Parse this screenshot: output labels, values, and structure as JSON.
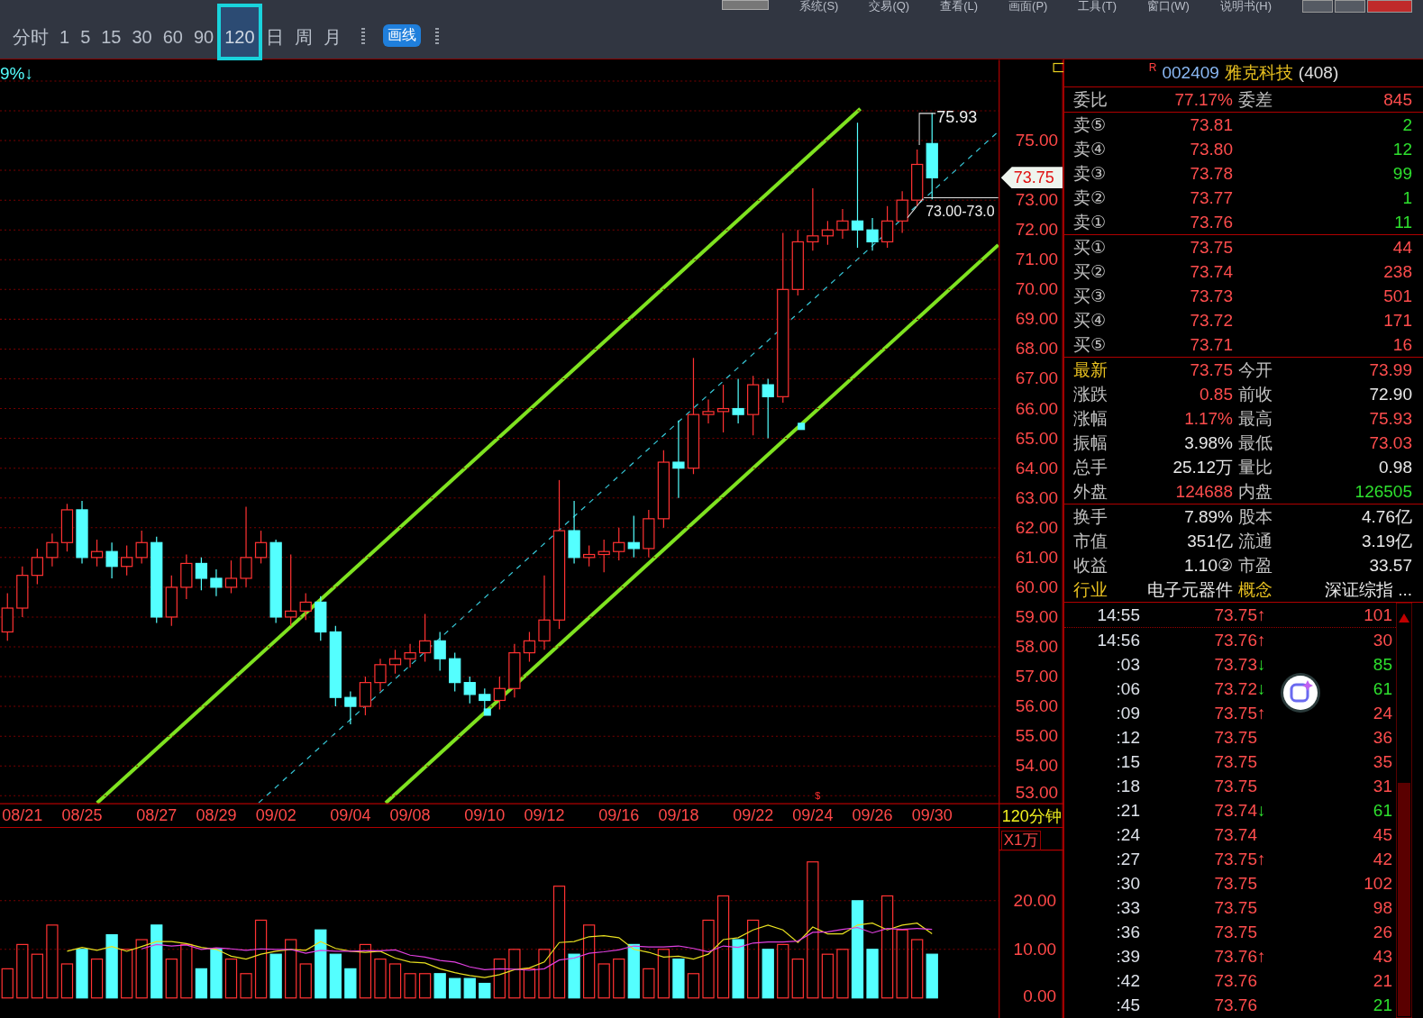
{
  "menu": [
    "系统(S)",
    "交易(Q)",
    "查看(L)",
    "画面(P)",
    "工具(T)",
    "窗口(W)",
    "说明书(H)"
  ],
  "toolbar": {
    "periods": [
      {
        "label": "分时",
        "selected": false
      },
      {
        "label": "1",
        "selected": false
      },
      {
        "label": "5",
        "selected": false
      },
      {
        "label": "15",
        "selected": false
      },
      {
        "label": "30",
        "selected": false
      },
      {
        "label": "60",
        "selected": false
      },
      {
        "label": "90",
        "selected": false
      },
      {
        "label": "120",
        "selected": true
      },
      {
        "label": "日",
        "selected": false
      },
      {
        "label": "周",
        "selected": false
      },
      {
        "label": "月",
        "selected": false
      }
    ],
    "draw_button": "画线"
  },
  "chart": {
    "change_label": "9%↓",
    "current_price": "73.75",
    "high_label": "75.93",
    "range_label": "73.00-73.0",
    "event_mark": "$",
    "period_label": "120分钟",
    "chart_data": {
      "type": "candlestick",
      "grid": true,
      "categories": [
        null,
        "08/21",
        null,
        null,
        null,
        "08/25",
        null,
        null,
        null,
        null,
        "08/27",
        null,
        null,
        null,
        "08/29",
        null,
        null,
        null,
        "09/02",
        null,
        null,
        null,
        null,
        "09/04",
        null,
        null,
        null,
        "09/08",
        null,
        null,
        null,
        null,
        "09/10",
        null,
        null,
        null,
        "09/12",
        null,
        null,
        null,
        null,
        "09/16",
        null,
        null,
        null,
        "09/18",
        null,
        null,
        null,
        null,
        "09/22",
        null,
        null,
        null,
        "09/24",
        null,
        null,
        null,
        "09/26",
        null,
        null,
        null,
        "09/30",
        null,
        null,
        null,
        null
      ],
      "ohlc": [
        [
          58.5,
          59.8,
          58.2,
          59.3
        ],
        [
          59.3,
          60.7,
          59.0,
          60.4
        ],
        [
          60.4,
          61.3,
          60.1,
          61.0
        ],
        [
          61.0,
          61.8,
          60.7,
          61.5
        ],
        [
          61.5,
          62.8,
          61.2,
          62.6
        ],
        [
          62.6,
          62.9,
          60.8,
          61.0
        ],
        [
          61.0,
          61.6,
          60.7,
          61.2
        ],
        [
          61.2,
          61.5,
          60.3,
          60.7
        ],
        [
          60.7,
          61.4,
          60.4,
          61.0
        ],
        [
          61.0,
          61.9,
          60.8,
          61.5
        ],
        [
          61.5,
          61.7,
          58.8,
          59.0
        ],
        [
          59.0,
          60.4,
          58.7,
          60.0
        ],
        [
          60.0,
          61.1,
          59.6,
          60.8
        ],
        [
          60.8,
          61.0,
          59.9,
          60.3
        ],
        [
          60.3,
          60.6,
          59.7,
          60.0
        ],
        [
          60.0,
          60.9,
          59.8,
          60.3
        ],
        [
          60.3,
          62.7,
          60.0,
          61.0
        ],
        [
          61.0,
          61.9,
          60.8,
          61.5
        ],
        [
          61.5,
          61.6,
          58.8,
          59.0
        ],
        [
          59.0,
          61.1,
          58.7,
          59.2
        ],
        [
          59.2,
          59.8,
          58.9,
          59.5
        ],
        [
          59.5,
          59.7,
          58.2,
          58.5
        ],
        [
          58.5,
          58.7,
          56.0,
          56.3
        ],
        [
          56.3,
          56.5,
          55.4,
          56.0
        ],
        [
          56.0,
          57.0,
          55.7,
          56.8
        ],
        [
          56.8,
          57.6,
          56.5,
          57.4
        ],
        [
          57.4,
          57.9,
          57.1,
          57.6
        ],
        [
          57.6,
          58.1,
          57.3,
          57.8
        ],
        [
          57.8,
          59.1,
          57.5,
          58.2
        ],
        [
          58.2,
          58.5,
          57.2,
          57.6
        ],
        [
          57.6,
          57.8,
          56.5,
          56.8
        ],
        [
          56.8,
          57.0,
          56.1,
          56.4
        ],
        [
          56.4,
          56.6,
          55.9,
          56.2
        ],
        [
          56.2,
          57.0,
          55.9,
          56.6
        ],
        [
          56.6,
          58.1,
          56.3,
          57.8
        ],
        [
          57.8,
          58.5,
          57.5,
          58.2
        ],
        [
          58.2,
          60.4,
          57.9,
          58.9
        ],
        [
          58.9,
          63.6,
          58.6,
          61.9
        ],
        [
          61.9,
          62.9,
          60.8,
          61.0
        ],
        [
          61.0,
          61.4,
          60.7,
          61.1
        ],
        [
          61.1,
          61.6,
          60.5,
          61.2
        ],
        [
          61.2,
          62.0,
          60.9,
          61.5
        ],
        [
          61.5,
          62.4,
          61.0,
          61.3
        ],
        [
          61.3,
          62.6,
          61.0,
          62.3
        ],
        [
          62.3,
          64.6,
          62.0,
          64.2
        ],
        [
          64.2,
          65.6,
          63.0,
          64.0
        ],
        [
          64.0,
          67.7,
          63.8,
          65.8
        ],
        [
          65.8,
          66.3,
          65.5,
          65.9
        ],
        [
          65.9,
          66.8,
          65.2,
          66.0
        ],
        [
          66.0,
          67.0,
          65.5,
          65.8
        ],
        [
          65.8,
          67.1,
          65.1,
          66.8
        ],
        [
          66.8,
          67.0,
          65.0,
          66.4
        ],
        [
          66.4,
          71.9,
          66.2,
          70.0
        ],
        [
          70.0,
          72.0,
          69.8,
          71.6
        ],
        [
          71.6,
          73.4,
          71.3,
          71.8
        ],
        [
          71.8,
          72.3,
          71.5,
          72.0
        ],
        [
          72.0,
          72.7,
          71.7,
          72.3
        ],
        [
          72.3,
          75.6,
          71.4,
          72.0
        ],
        [
          72.0,
          72.4,
          71.3,
          71.6
        ],
        [
          71.6,
          72.8,
          71.4,
          72.3
        ],
        [
          72.3,
          73.3,
          71.9,
          73.0
        ],
        [
          73.0,
          74.7,
          72.8,
          74.2
        ],
        [
          74.9,
          75.93,
          73.03,
          73.75
        ],
        null,
        null,
        null,
        null
      ],
      "yticks": [
        {
          "value": 75,
          "label": "75.00"
        },
        {
          "value": 73,
          "label": "73.00"
        },
        {
          "value": 72,
          "label": "72.00"
        },
        {
          "value": 71,
          "label": "71.00"
        },
        {
          "value": 70,
          "label": "70.00"
        },
        {
          "value": 69,
          "label": "69.00"
        },
        {
          "value": 68,
          "label": "68.00"
        },
        {
          "value": 67,
          "label": "67.00"
        },
        {
          "value": 66,
          "label": "66.00"
        },
        {
          "value": 65,
          "label": "65.00"
        },
        {
          "value": 64,
          "label": "64.00"
        },
        {
          "value": 63,
          "label": "63.00"
        },
        {
          "value": 62,
          "label": "62.00"
        },
        {
          "value": 61,
          "label": "61.00"
        },
        {
          "value": 60,
          "label": "60.00"
        },
        {
          "value": 59,
          "label": "59.00"
        },
        {
          "value": 58,
          "label": "58.00"
        },
        {
          "value": 57,
          "label": "57.00"
        },
        {
          "value": 56,
          "label": "56.00"
        },
        {
          "value": 55,
          "label": "55.00"
        },
        {
          "value": 54,
          "label": "54.00"
        },
        {
          "value": 53,
          "label": "53.00"
        }
      ],
      "ylim": [
        52.73,
        77.71
      ]
    }
  },
  "volume": {
    "unit": "X1万",
    "chart_data": {
      "type": "bar",
      "grid": true,
      "series": [
        {
          "type": "bar",
          "color": "#ff3232",
          "values": [
            6,
            11,
            9,
            15,
            7,
            null,
            8,
            null,
            10,
            12,
            null,
            8,
            11,
            null,
            null,
            8,
            5,
            16,
            null,
            12,
            7,
            null,
            null,
            null,
            11,
            8,
            7,
            5,
            5,
            null,
            null,
            null,
            null,
            8,
            10,
            6,
            10,
            23,
            null,
            15,
            7,
            8,
            null,
            6,
            10,
            null,
            5,
            16,
            21,
            null,
            16,
            null,
            11,
            8,
            28,
            9,
            10,
            null,
            null,
            21,
            14,
            12,
            null,
            null,
            null,
            null,
            null
          ]
        },
        {
          "type": "bar",
          "color": "#54ffff",
          "values": [
            null,
            null,
            null,
            null,
            null,
            10,
            null,
            13,
            null,
            null,
            15,
            null,
            null,
            6,
            10,
            null,
            null,
            null,
            9,
            null,
            null,
            14,
            9,
            6,
            null,
            null,
            null,
            null,
            null,
            5,
            4,
            4,
            3,
            null,
            null,
            null,
            null,
            null,
            9,
            null,
            null,
            null,
            11,
            null,
            null,
            8,
            null,
            null,
            null,
            12,
            null,
            10,
            null,
            null,
            null,
            null,
            null,
            20,
            10,
            null,
            null,
            null,
            9,
            null,
            null,
            null,
            null
          ]
        },
        {
          "type": "line",
          "color": "#e8e020",
          "values": [
            null,
            null,
            null,
            null,
            9.6,
            10.4,
            9.8,
            10.6,
            9.6,
            10.6,
            11.6,
            11.6,
            11.2,
            10.4,
            10,
            8.6,
            8,
            9,
            9.6,
            10,
            9.8,
            11.6,
            10.2,
            9.6,
            9.4,
            9.6,
            8.2,
            7.4,
            7.2,
            6,
            5.2,
            4.6,
            4.2,
            4.8,
            5.8,
            6.2,
            7.4,
            11.4,
            11.6,
            12.6,
            12.8,
            12.4,
            10,
            9.4,
            8.4,
            8.6,
            8,
            9,
            12,
            12.4,
            14,
            15,
            14,
            11.4,
            14.6,
            13.2,
            13.2,
            15,
            15.4,
            14,
            15,
            15.4,
            13.2,
            null,
            null,
            null,
            null
          ]
        },
        {
          "type": "line",
          "color": "#e040e0",
          "values": [
            null,
            null,
            null,
            null,
            null,
            null,
            null,
            null,
            null,
            10.1,
            11,
            10.7,
            10.9,
            10,
            10.3,
            10.1,
            9.8,
            10.1,
            10,
            10,
            9.2,
            9.8,
            9.6,
            9.6,
            9.7,
            9.7,
            9.9,
            8.8,
            8.4,
            7.7,
            7.4,
            6.4,
            5.8,
            6,
            5.9,
            5.7,
            6,
            7.8,
            8.2,
            9.2,
            9.5,
            9.9,
            10.7,
            10.5,
            10.5,
            10.7,
            10.2,
            9.5,
            10.7,
            10.4,
            11.3,
            11.5,
            11.5,
            11.7,
            13.5,
            13.6,
            14.1,
            14.5,
            13.4,
            14.3,
            14.1,
            14.3,
            14.1,
            null,
            null,
            null,
            null
          ]
        }
      ],
      "yticks": [
        {
          "value": 20,
          "label": "20.00"
        },
        {
          "value": 10,
          "label": "10.00"
        },
        {
          "value": 0,
          "label": "0.00"
        }
      ],
      "ylim": [
        0,
        35.1
      ]
    }
  },
  "quote": {
    "marker": "R",
    "code": "002409",
    "name": "雅克科技",
    "count": "(408)",
    "ratio": {
      "label": "委比",
      "value": "77.17%",
      "label2": "委差",
      "value2": "845"
    },
    "asks": [
      {
        "label": "卖⑤",
        "price": "73.81",
        "volume": "2"
      },
      {
        "label": "卖④",
        "price": "73.80",
        "volume": "12"
      },
      {
        "label": "卖③",
        "price": "73.78",
        "volume": "99"
      },
      {
        "label": "卖②",
        "price": "73.77",
        "volume": "1"
      },
      {
        "label": "卖①",
        "price": "73.76",
        "volume": "11"
      }
    ],
    "bids": [
      {
        "label": "买①",
        "price": "73.75",
        "volume": "44"
      },
      {
        "label": "买②",
        "price": "73.74",
        "volume": "238"
      },
      {
        "label": "买③",
        "price": "73.73",
        "volume": "501"
      },
      {
        "label": "买④",
        "price": "73.72",
        "volume": "171"
      },
      {
        "label": "买⑤",
        "price": "73.71",
        "volume": "16"
      }
    ],
    "stats": [
      {
        "label": "最新",
        "label_highlight": true,
        "value": "73.75",
        "value_rising": true,
        "value_falling": false,
        "label2": "今开",
        "label2_highlight": false,
        "value2": "73.99",
        "value2_rising": true,
        "value2_falling": false
      },
      {
        "label": "涨跌",
        "label_highlight": false,
        "value": "0.85",
        "value_rising": true,
        "value_falling": false,
        "label2": "前收",
        "label2_highlight": false,
        "value2": "72.90",
        "value2_rising": false,
        "value2_falling": false
      },
      {
        "label": "涨幅",
        "label_highlight": false,
        "value": "1.17%",
        "value_rising": true,
        "value_falling": false,
        "label2": "最高",
        "label2_highlight": false,
        "value2": "75.93",
        "value2_rising": true,
        "value2_falling": false
      },
      {
        "label": "振幅",
        "label_highlight": false,
        "value": "3.98%",
        "value_rising": false,
        "value_falling": false,
        "label2": "最低",
        "label2_highlight": false,
        "value2": "73.03",
        "value2_rising": true,
        "value2_falling": false
      },
      {
        "label": "总手",
        "label_highlight": false,
        "value": "25.12万",
        "value_rising": false,
        "value_falling": false,
        "label2": "量比",
        "label2_highlight": false,
        "value2": "0.98",
        "value2_rising": false,
        "value2_falling": false
      },
      {
        "label": "外盘",
        "label_highlight": false,
        "value": "124688",
        "value_rising": true,
        "value_falling": false,
        "label2": "内盘",
        "label2_highlight": false,
        "value2": "126505",
        "value2_rising": false,
        "value2_falling": true
      }
    ],
    "info": [
      {
        "label": "换手",
        "label_highlight": false,
        "value": "7.89%",
        "label2": "股本",
        "label2_highlight": false,
        "value2": "4.76亿"
      },
      {
        "label": "市值",
        "label_highlight": false,
        "value": "351亿",
        "label2": "流通",
        "label2_highlight": false,
        "value2": "3.19亿"
      },
      {
        "label": "收益",
        "label_highlight": false,
        "value": "1.10②",
        "label2": "市盈",
        "label2_highlight": false,
        "value2": "33.57"
      },
      {
        "label": "行业",
        "label_highlight": true,
        "value": "电子元器件",
        "label2": "概念",
        "label2_highlight": true,
        "value2": "深证综指 ..."
      }
    ]
  },
  "ticks": [
    {
      "time": "14:55",
      "price": "73.75",
      "arrow": "↑",
      "falling": false,
      "volume": "101",
      "sell": false
    },
    {
      "time": "14:56",
      "price": "73.76",
      "arrow": "↑",
      "falling": false,
      "volume": "30",
      "sell": false
    },
    {
      "time": ":03",
      "price": "73.73",
      "arrow": "↓",
      "falling": true,
      "volume": "85",
      "sell": true
    },
    {
      "time": ":06",
      "price": "73.72",
      "arrow": "↓",
      "falling": true,
      "volume": "61",
      "sell": true
    },
    {
      "time": ":09",
      "price": "73.75",
      "arrow": "↑",
      "falling": false,
      "volume": "24",
      "sell": false
    },
    {
      "time": ":12",
      "price": "73.75",
      "volume": "36",
      "sell": false
    },
    {
      "time": ":15",
      "price": "73.75",
      "volume": "35",
      "sell": false
    },
    {
      "time": ":18",
      "price": "73.75",
      "volume": "31",
      "sell": false
    },
    {
      "time": ":21",
      "price": "73.74",
      "arrow": "↓",
      "falling": true,
      "volume": "61",
      "sell": true
    },
    {
      "time": ":24",
      "price": "73.74",
      "volume": "45",
      "sell": false
    },
    {
      "time": ":27",
      "price": "73.75",
      "arrow": "↑",
      "falling": false,
      "volume": "42",
      "sell": false
    },
    {
      "time": ":30",
      "price": "73.75",
      "volume": "102",
      "sell": false
    },
    {
      "time": ":33",
      "price": "73.75",
      "volume": "98",
      "sell": false
    },
    {
      "time": ":36",
      "price": "73.75",
      "volume": "26",
      "sell": false
    },
    {
      "time": ":39",
      "price": "73.76",
      "arrow": "↑",
      "falling": false,
      "volume": "43",
      "sell": false
    },
    {
      "time": ":42",
      "price": "73.76",
      "volume": "21",
      "sell": false
    },
    {
      "time": ":45",
      "price": "73.76",
      "volume": "21",
      "sell": true
    }
  ]
}
